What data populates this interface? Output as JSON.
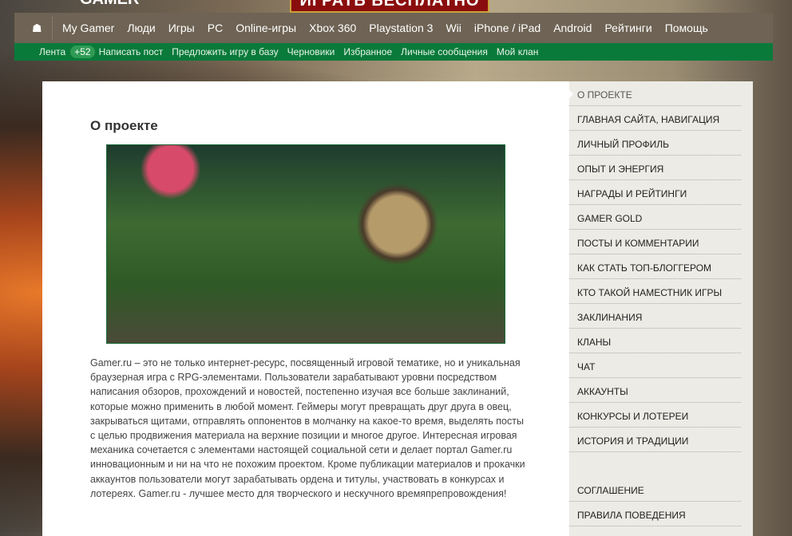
{
  "header": {
    "logo": "GAMER",
    "banner": "ИГРАТЬ БЕСПЛАТНО"
  },
  "nav": {
    "home_icon": "home-icon",
    "items": [
      "My Gamer",
      "Люди",
      "Игры",
      "PC",
      "Online-игры",
      "Xbox 360",
      "Playstation 3",
      "Wii",
      "iPhone / iPad",
      "Android",
      "Рейтинги",
      "Помощь"
    ]
  },
  "subnav": {
    "feed": "Лента",
    "feed_badge": "+52",
    "items": [
      "Написать пост",
      "Предложить игру в базу",
      "Черновики",
      "Избранное",
      "Личные сообщения",
      "Мой клан"
    ]
  },
  "main": {
    "title": "О проекте",
    "text": "Gamer.ru – это не только интернет-ресурс, посвященный игровой тематике, но и уникальная браузерная игра с RPG-элементами. Пользователи зарабатывают уровни посредством написания обзоров, прохождений и новостей, постепенно изучая все больше заклинаний, которые можно применить в любой момент. Геймеры могут превращать друг друга в овец, закрываться щитами, отправлять оппонентов в молчанку на какое-то время, выделять посты с целью продвижения материала на верхние позиции и многое другое. Интересная игровая механика сочетается с элементами настоящей социальной сети и делает портал Gamer.ru инновационным и ни на что не похожим проектом. Кроме публикации материалов и прокачки аккаунтов пользователи могут зарабатывать ордена и титулы, участвовать в конкурсах и лотереях. Gamer.ru - лучшее место для творческого и нескучного времяпрепровождения!"
  },
  "sidebar": {
    "items": [
      "О ПРОЕКТЕ",
      "ГЛАВНАЯ САЙТА, НАВИГАЦИЯ",
      "ЛИЧНЫЙ ПРОФИЛЬ",
      "ОПЫТ И ЭНЕРГИЯ",
      "НАГРАДЫ И РЕЙТИНГИ",
      "GAMER GOLD",
      "ПОСТЫ И КОММЕНТАРИИ",
      "КАК СТАТЬ ТОП-БЛОГГЕРОМ",
      "КТО ТАКОЙ НАМЕСТНИК ИГРЫ",
      "ЗАКЛИНАНИЯ",
      "КЛАНЫ",
      "ЧАТ",
      "АККАУНТЫ",
      "КОНКУРСЫ И ЛОТЕРЕИ",
      "ИСТОРИЯ И ТРАДИЦИИ",
      "",
      "СОГЛАШЕНИЕ",
      "ПРАВИЛА ПОВЕДЕНИЯ"
    ],
    "active": "О ПРОЕКТЕ"
  },
  "colors": {
    "nav": "#6e6354",
    "subnav": "#0a7a3b",
    "sidebar": "#ecebe5"
  }
}
